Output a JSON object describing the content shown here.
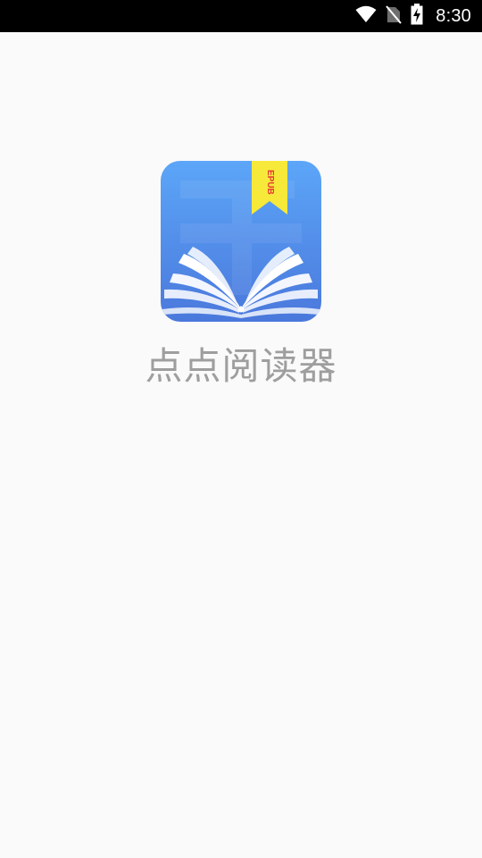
{
  "status_bar": {
    "time": "8:30",
    "icons": [
      "wifi-icon",
      "no-sim-icon",
      "battery-charging-icon"
    ]
  },
  "splash": {
    "app_name": "点点阅读器",
    "icon_badge_text": "EPUB"
  },
  "colors": {
    "status_bar_bg": "#000000",
    "background": "#fafafa",
    "icon_blue_top": "#5aa2f6",
    "icon_blue_bottom": "#4a7ee0",
    "bookmark_yellow": "#f7e93a",
    "badge_text_red": "#e53935",
    "app_name_text": "#9e9e9e"
  }
}
